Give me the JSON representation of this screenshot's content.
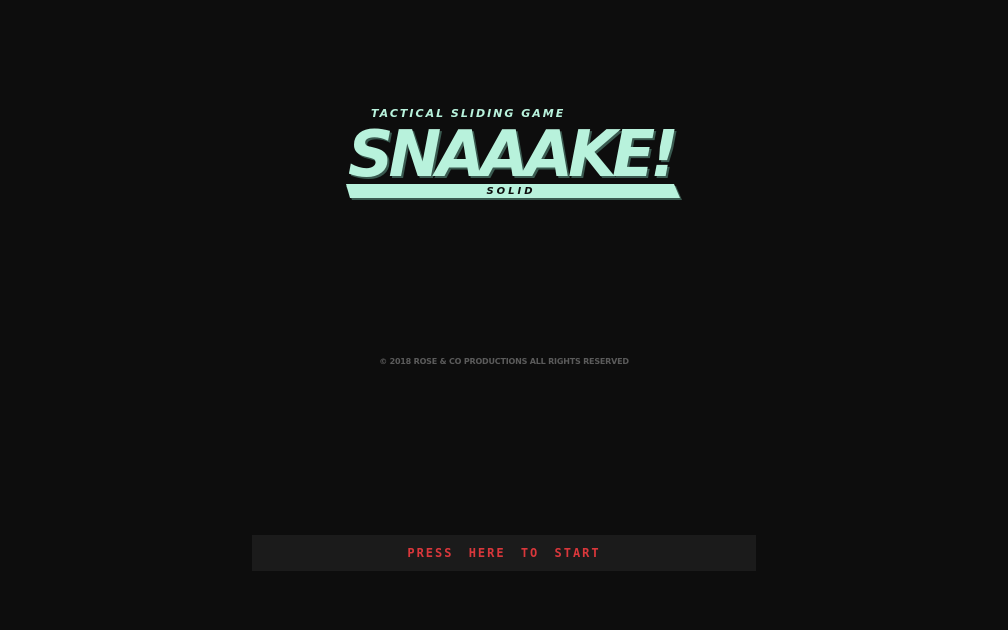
{
  "logo": {
    "tagline": "TACTICAL SLIDING GAME",
    "title": "SNAAAKE!",
    "subtitle": "SOLID",
    "color": "#b8f2dc",
    "shadow_color": "#3a5a50"
  },
  "copyright": "© 2018 ROSE & CO PRODUCTIONS ALL RIGHTS RESERVED",
  "start_button": {
    "label": "PRESS HERE TO START",
    "text_color": "#d9373b",
    "background": "#1b1b1b"
  },
  "colors": {
    "background": "#0d0d0d",
    "copyright_text": "#5b5b5b"
  }
}
